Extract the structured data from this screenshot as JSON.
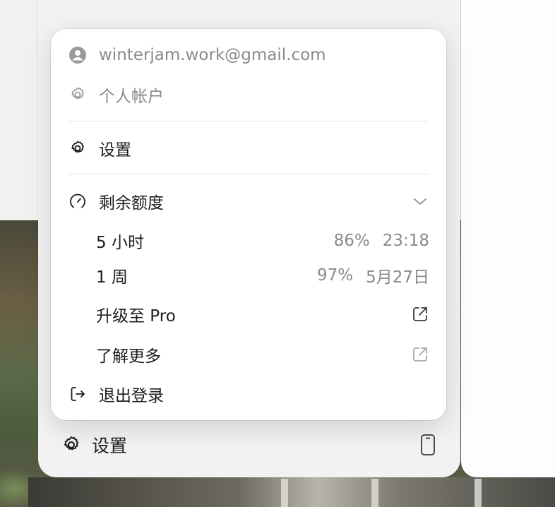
{
  "account": {
    "email": "winterjam.work@gmail.com",
    "personal_account_label": "个人帐户"
  },
  "menu": {
    "settings_label": "设置",
    "quota": {
      "label": "剩余额度",
      "rows": [
        {
          "label": "5 小时",
          "percent": "86%",
          "reset": "23:18"
        },
        {
          "label": "1 周",
          "percent": "97%",
          "reset": "5月27日"
        }
      ]
    },
    "upgrade_label": "升级至 Pro",
    "learn_more_label": "了解更多",
    "logout_label": "退出登录"
  },
  "footer": {
    "settings_label": "设置"
  },
  "icons": {
    "account": "user-circle-icon",
    "personal": "gear-icon",
    "settings": "gear-icon",
    "quota": "gauge-icon",
    "expand": "chevron-down-icon",
    "external": "external-link-icon",
    "logout": "logout-icon",
    "device": "phone-icon"
  },
  "colors": {
    "text": "#1d1d1f",
    "muted": "#8a8a8e",
    "menu_bg": "#ffffff",
    "panel_bg": "#f2f2f2"
  }
}
